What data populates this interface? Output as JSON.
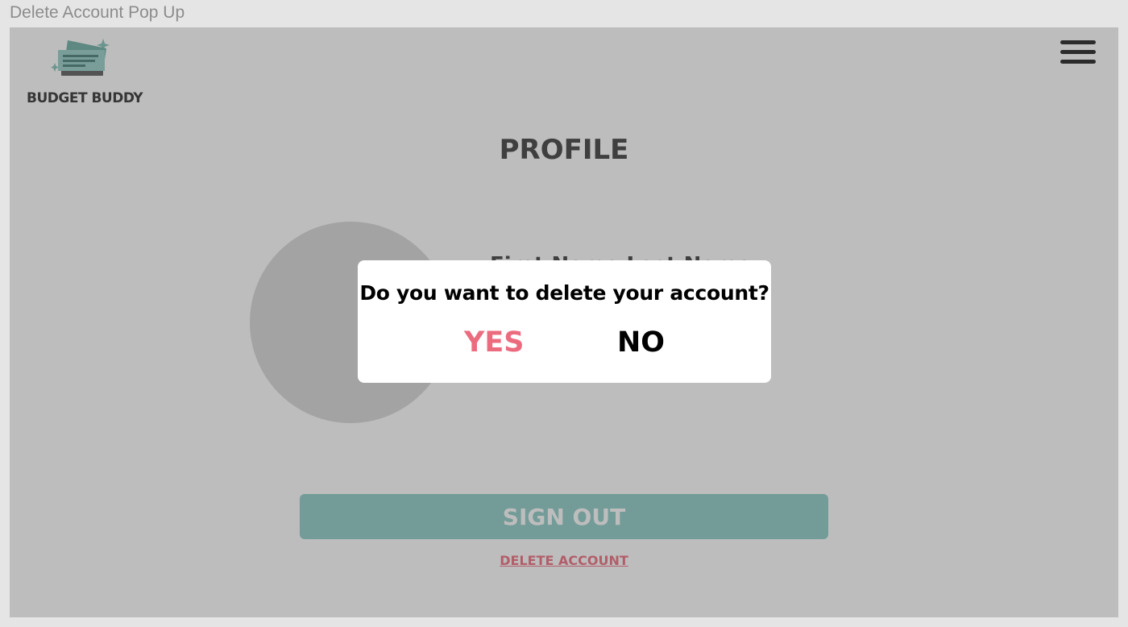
{
  "frame": {
    "title": "Delete Account Pop Up"
  },
  "header": {
    "logo_text": "BUDGET BUDDY",
    "menu_icon": "hamburger-menu-icon"
  },
  "profile": {
    "page_title": "PROFILE",
    "user_name": "First Name Last Name",
    "sign_out_label": "SIGN OUT",
    "delete_account_label": "DELETE ACCOUNT"
  },
  "dialog": {
    "question": "Do you want to delete your account?",
    "yes_label": "YES",
    "no_label": "NO"
  },
  "colors": {
    "accent_teal": "#9cd3cd",
    "danger_pink": "#ec6c7f",
    "overlay": "rgba(0,0,0,0.26)"
  }
}
